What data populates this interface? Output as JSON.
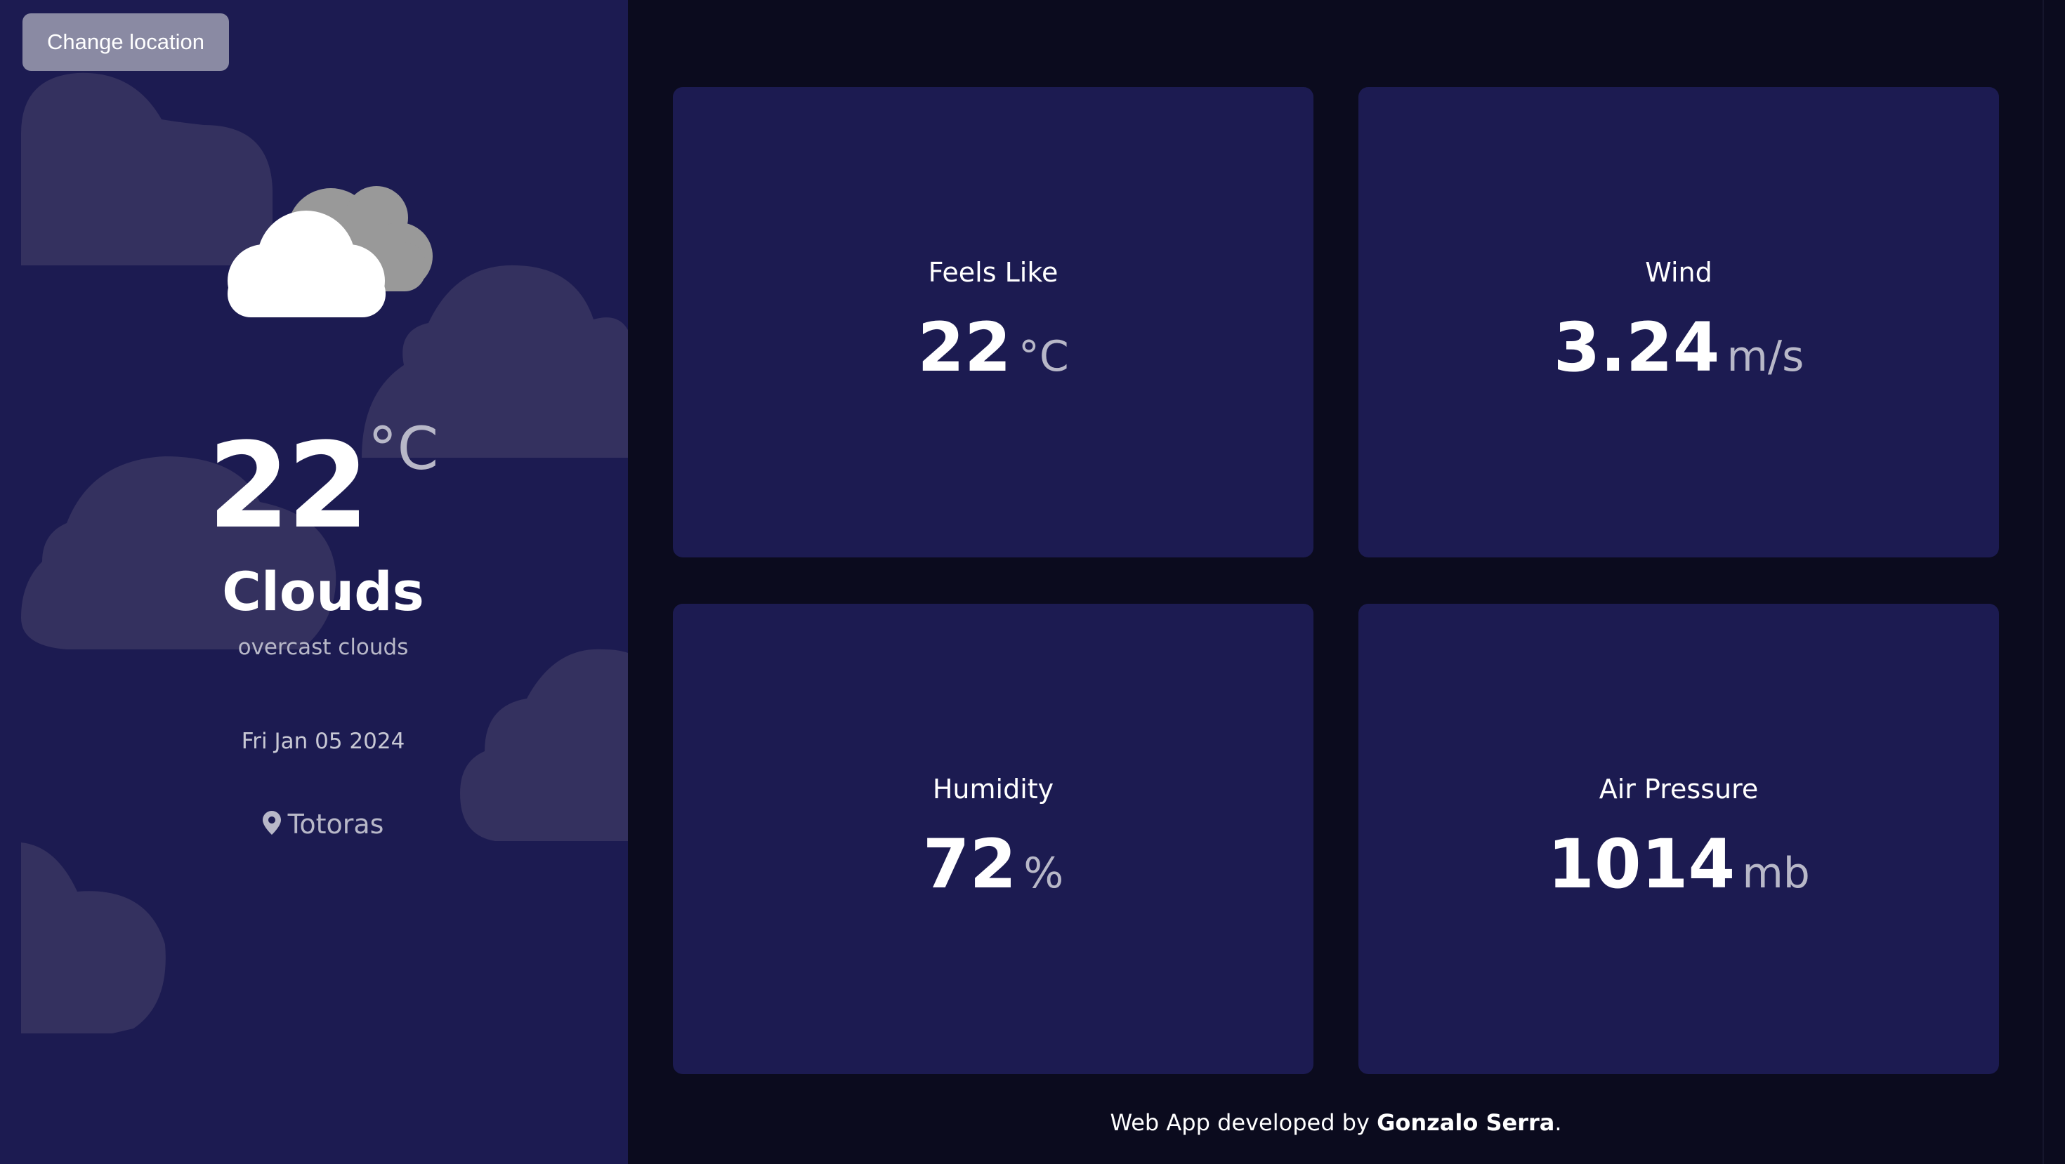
{
  "sidebar": {
    "change_location_label": "Change location",
    "temperature": "22",
    "temperature_unit": "°C",
    "condition": "Clouds",
    "description": "overcast clouds",
    "date": "Fri Jan 05 2024",
    "location": "Totoras",
    "weather_icon": "clouds-icon"
  },
  "cards": {
    "feels_like": {
      "label": "Feels Like",
      "value": "22",
      "unit": "°C"
    },
    "wind": {
      "label": "Wind",
      "value": "3.24",
      "unit": "m/s"
    },
    "humidity": {
      "label": "Humidity",
      "value": "72",
      "unit": "%"
    },
    "air_pressure": {
      "label": "Air Pressure",
      "value": "1014",
      "unit": "mb"
    }
  },
  "footer": {
    "prefix": "Web App developed by ",
    "author": "Gonzalo Serra",
    "suffix": "."
  },
  "colors": {
    "background": "#0b0b1e",
    "panel": "#1c1b51",
    "button": "#8a8aa3",
    "muted_text": "#b8b8c8"
  }
}
